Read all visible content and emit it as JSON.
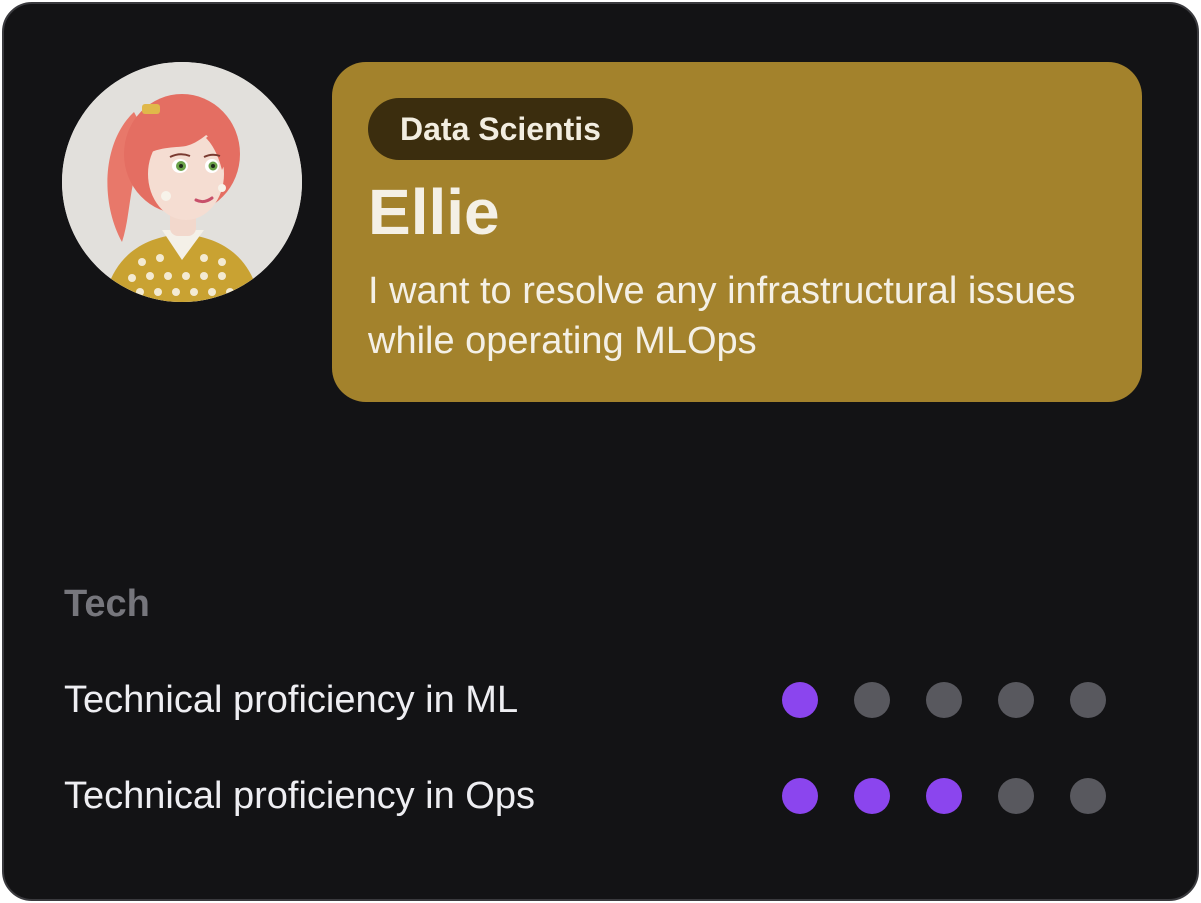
{
  "persona": {
    "role": "Data Scientis",
    "name": "Ellie",
    "goal": "I want to resolve any infrastructural issues while operating MLOps",
    "accent_color": "#a3822c",
    "avatar_icon": "cartoon-woman-avatar"
  },
  "tech": {
    "title": "Tech",
    "max_rating": 5,
    "filled_color": "#8b45ee",
    "empty_color": "#58585e",
    "skills": [
      {
        "label": "Technical proficiency in ML",
        "rating": 1
      },
      {
        "label": "Technical proficiency in Ops",
        "rating": 3
      }
    ]
  }
}
